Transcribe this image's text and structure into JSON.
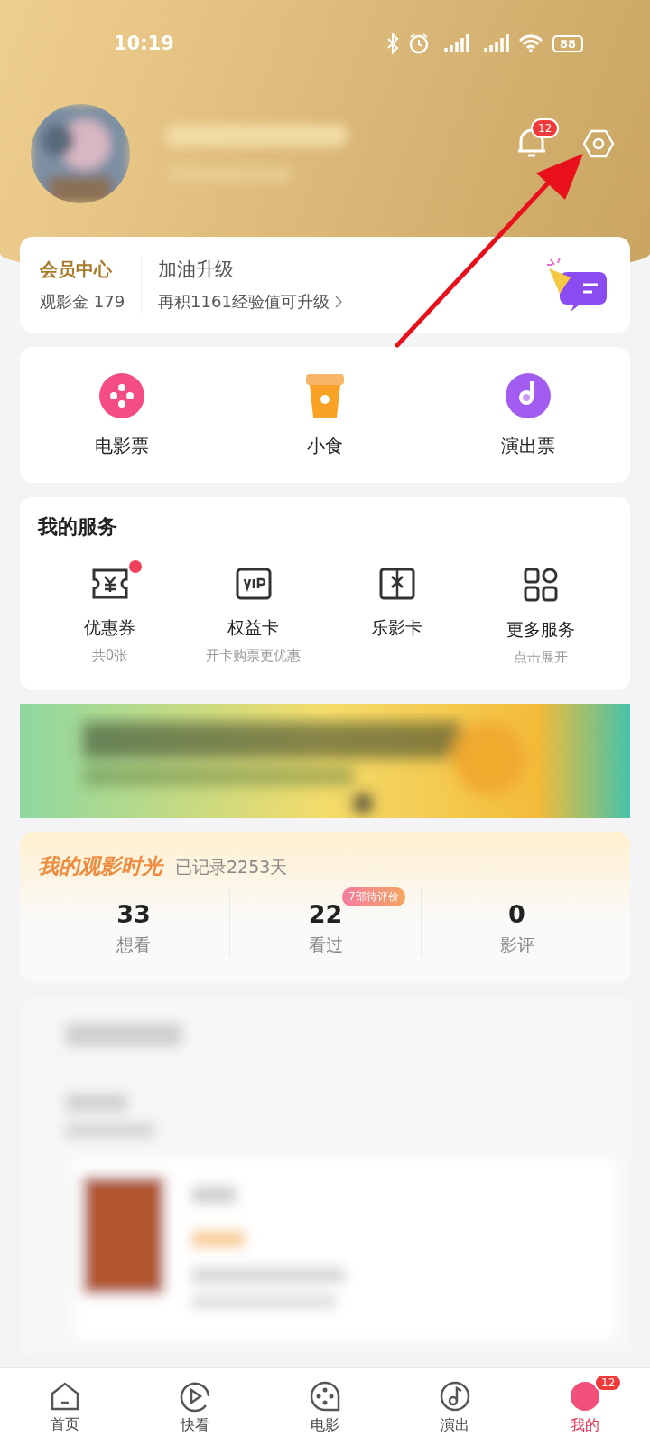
{
  "status_bar": {
    "time": "10:19",
    "battery": "88"
  },
  "profile": {
    "notification_count": "12"
  },
  "member": {
    "title": "会员中心",
    "coins": "观影金 179",
    "level_title": "加油升级",
    "level_hint": "再积1161经验值可升级"
  },
  "quick_entries": [
    {
      "label": "电影票",
      "kind": "movie"
    },
    {
      "label": "小食",
      "kind": "snack"
    },
    {
      "label": "演出票",
      "kind": "show"
    }
  ],
  "services": {
    "title": "我的服务",
    "items": [
      {
        "label": "优惠券",
        "sub": "共0张",
        "kind": "coupon",
        "dot": true
      },
      {
        "label": "权益卡",
        "sub": "开卡购票更优惠",
        "kind": "vip",
        "dot": false
      },
      {
        "label": "乐影卡",
        "kind": "gift",
        "dot": false
      },
      {
        "label": "更多服务",
        "sub": "点击展开",
        "kind": "grid",
        "dot": false
      }
    ]
  },
  "timeline": {
    "title": "我的观影时光",
    "subtitle": "已记录2253天",
    "stats": [
      {
        "value": "33",
        "label": "想看"
      },
      {
        "value": "22",
        "label": "看过",
        "badge": "7部待评价"
      },
      {
        "value": "0",
        "label": "影评"
      }
    ]
  },
  "nav": [
    {
      "label": "首页",
      "kind": "home",
      "selected": false
    },
    {
      "label": "快看",
      "kind": "play",
      "selected": false
    },
    {
      "label": "电影",
      "kind": "film",
      "selected": false
    },
    {
      "label": "演出",
      "kind": "music",
      "selected": false
    },
    {
      "label": "我的",
      "kind": "me",
      "selected": true,
      "badge": "12"
    }
  ]
}
